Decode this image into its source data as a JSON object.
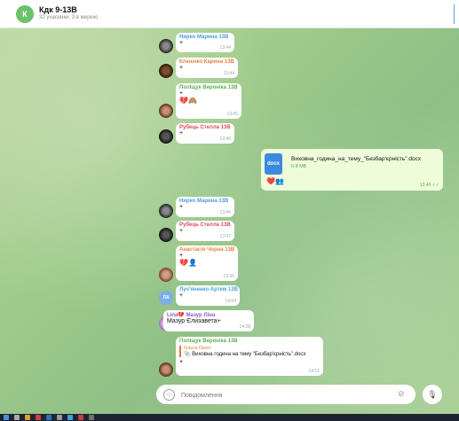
{
  "header": {
    "avatar_letter": "К",
    "title": "Кдк 9-13В",
    "subtitle": "32 учасники, 3 в мережі"
  },
  "messages": [
    {
      "name": "Нирко Марина 13В",
      "text": "+",
      "time": "13:44",
      "name_color": "#4a9fe0"
    },
    {
      "name": "Клюєнко Карина 13В",
      "text": "+",
      "time": "13:44",
      "name_color": "#e8823a"
    },
    {
      "name": "Поліщук Вероніка 13В",
      "text": "+",
      "time": "13:45",
      "name_color": "#5bb04f",
      "reactions": "💔🙈"
    },
    {
      "name": "Рубець Стелла 13В",
      "text": "+",
      "time": "13:45",
      "name_color": "#e04a5a"
    },
    {
      "name": "Нирко Марина 13В",
      "text": "+",
      "time": "13:46",
      "name_color": "#4a9fe0"
    },
    {
      "name": "Рубець Стелла 13В",
      "text": "+",
      "time": "13:47",
      "name_color": "#e04a5a"
    },
    {
      "name": "Анастасія Чорна 13В",
      "text": "+",
      "time": "13:50",
      "name_color": "#e8823a",
      "reactions": "💔👤"
    },
    {
      "name": "Луч'яненко Артем 13В",
      "text": "+",
      "time": "14:04",
      "name_color": "#4a9fe0",
      "avatar_text": "ЛА"
    },
    {
      "name": "Lina💔 Мазур Ліна",
      "text": "Мазур Єлизавета+",
      "time": "14:28",
      "name_color": "#8f5bd0"
    },
    {
      "name": "Поліщук Вероніка 13В",
      "quote_name": "Ольга Орел",
      "quote_text": "📎 Виховна година на тему \"Безбар'єрність\".docx",
      "text": "+",
      "time": "14:51",
      "name_color": "#5bb04f"
    }
  ],
  "file_message": {
    "icon_label": "docx",
    "file_name": "Виховна_година_на_тему_\"Безбар'єрність\".docx",
    "file_size": "0.8 МБ",
    "reactions": "❤️👥",
    "time": "13:46 ✓✓"
  },
  "input": {
    "placeholder": "Повідомлення"
  },
  "colors": {
    "accent": "#4fa048",
    "file_bubble": "#eefdd9",
    "doc_icon": "#3a8be0"
  }
}
